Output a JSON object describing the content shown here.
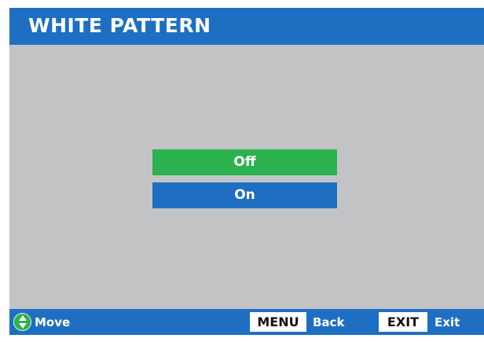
{
  "header": {
    "title": "WHITE PATTERN"
  },
  "options": [
    {
      "label": "Off",
      "selected": true
    },
    {
      "label": "On",
      "selected": false
    }
  ],
  "footer": {
    "move": {
      "icon": "up-down-arrows-icon",
      "label": "Move"
    },
    "menu": {
      "key": "MENU",
      "label": "Back"
    },
    "exit": {
      "key": "EXIT",
      "label": "Exit"
    }
  },
  "colors": {
    "background": "#c2c3c5",
    "bar_blue": "#1e6fc1",
    "selected_green": "#2bb24e",
    "text": "#ffffff"
  }
}
